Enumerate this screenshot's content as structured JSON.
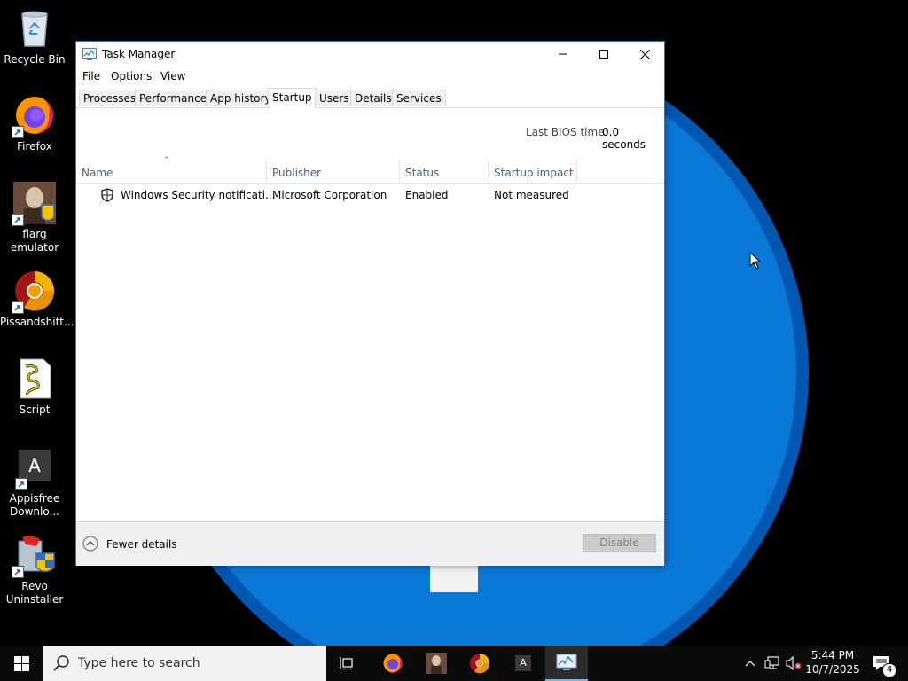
{
  "desktop": {
    "icons": [
      {
        "label": "Recycle Bin"
      },
      {
        "label": "Firefox"
      },
      {
        "label_line1": "flarg",
        "label_line2": "emulator"
      },
      {
        "label": "Pissandshitt..."
      },
      {
        "label": "Script"
      },
      {
        "label_line1": "Appisfree",
        "label_line2": "Downlo..."
      },
      {
        "label_line1": "Revo",
        "label_line2": "Uninstaller"
      }
    ],
    "appisfree_letter": "A"
  },
  "window": {
    "title": "Task Manager",
    "menu": [
      "File",
      "Options",
      "View"
    ],
    "tabs": [
      {
        "label": "Processes",
        "active": false
      },
      {
        "label": "Performance",
        "active": false
      },
      {
        "label": "App history",
        "active": false
      },
      {
        "label": "Startup",
        "active": true
      },
      {
        "label": "Users",
        "active": false
      },
      {
        "label": "Details",
        "active": false
      },
      {
        "label": "Services",
        "active": false
      }
    ],
    "bios_label": "Last BIOS time:",
    "bios_value": "0.0 seconds",
    "columns": [
      "Name",
      "Publisher",
      "Status",
      "Startup impact"
    ],
    "rows": [
      {
        "icon": "shield-icon",
        "name": "Windows Security notificati...",
        "publisher": "Microsoft Corporation",
        "status": "Enabled",
        "impact": "Not measured"
      }
    ],
    "footer": {
      "fewer_details": "Fewer details",
      "disable": "Disable"
    }
  },
  "taskbar": {
    "search_placeholder": "Type here to search",
    "pinned": [
      "task-view-icon",
      "firefox-icon",
      "flarg-emulator-icon",
      "chrome-icon",
      "appisfree-icon",
      "task-manager-icon"
    ],
    "appisfree_letter": "A",
    "clock_time": "5:44 PM",
    "clock_date": "10/7/2025",
    "notification_count": "4"
  },
  "colors": {
    "wallpaper_blue": "#0a78d7",
    "wallpaper_edge": "#0057b0",
    "accent": "#76b9ed"
  }
}
